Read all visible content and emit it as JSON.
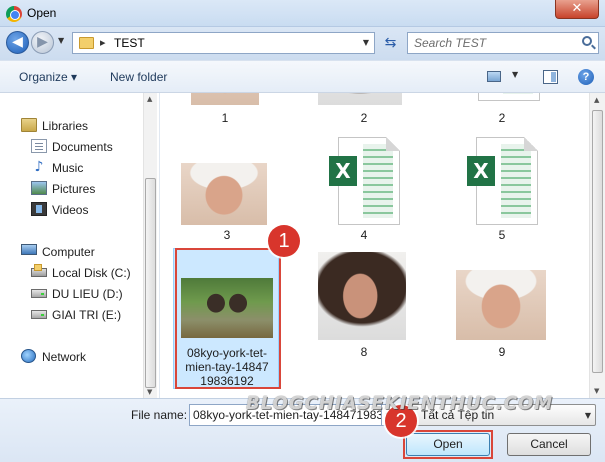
{
  "window": {
    "title": "Open",
    "close_glyph": "✕"
  },
  "address": {
    "separator": "▸",
    "breadcrumb": "TEST",
    "search_placeholder": "Search TEST"
  },
  "toolbar": {
    "organize_label": "Organize ▾",
    "new_folder_label": "New folder",
    "help_glyph": "?"
  },
  "nav": {
    "libraries": "Libraries",
    "documents": "Documents",
    "music": "Music",
    "pictures": "Pictures",
    "videos": "Videos",
    "computer": "Computer",
    "local_disk": "Local Disk (C:)",
    "du_lieu": "DU LIEU (D:)",
    "giai_tri": "GIAI TRI (E:)",
    "network": "Network"
  },
  "files": {
    "row0": [
      "1",
      "2",
      "2"
    ],
    "row1": [
      "3",
      "4",
      "5"
    ],
    "selected_label": "08kyo-york-tet-mien-tay-1484719836192",
    "row2": [
      "8",
      "9"
    ],
    "excel_letter": "X"
  },
  "bottom": {
    "file_name_label": "File name:",
    "file_name_value": "08kyo-york-tet-mien-tay-1484719836192",
    "file_type_value": "Tất cả Tệp tin",
    "open_label": "Open",
    "cancel_label": "Cancel"
  },
  "annotations": {
    "step1": "1",
    "step2": "2"
  },
  "watermark": "BLOGCHIASEKIENTHUC.COM",
  "colors": {
    "accent_red": "#d9463a",
    "excel_green": "#217346",
    "selection_blue": "#cce8ff"
  }
}
